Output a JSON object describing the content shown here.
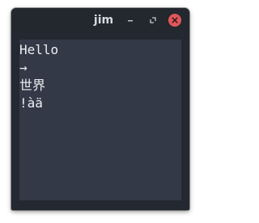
{
  "window": {
    "title": "jim",
    "controls": {
      "minimize_icon": "minimize-icon",
      "maximize_icon": "maximize-icon",
      "close_icon": "close-icon",
      "close_color": "#e0575b"
    }
  },
  "terminal": {
    "background": "#333946",
    "foreground": "#eceff4",
    "lines": [
      "Hello",
      "→",
      "世界",
      "!àä"
    ]
  }
}
